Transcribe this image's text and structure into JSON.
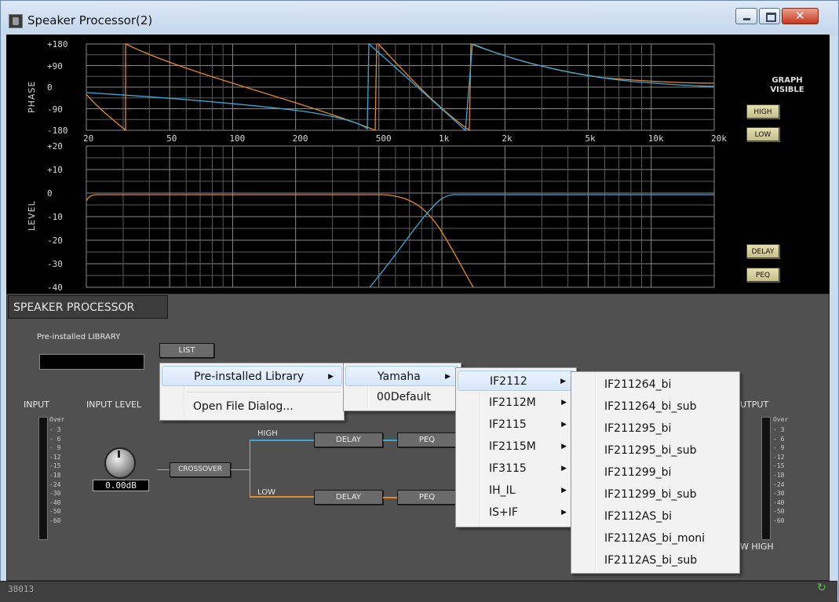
{
  "window": {
    "title": "Speaker Processor(2)"
  },
  "graph": {
    "phase_label": "PHASE",
    "level_label": "LEVEL",
    "phase_ticks": [
      "+180",
      "+90",
      "0",
      "-90",
      "-180"
    ],
    "level_ticks": [
      "+20",
      "+10",
      "0",
      "-10",
      "-20",
      "-30",
      "-40"
    ],
    "freq_ticks": [
      "20",
      "50",
      "100",
      "200",
      "500",
      "1k",
      "2k",
      "5k",
      "10k",
      "20k"
    ],
    "graph_visible_label_1": "GRAPH",
    "graph_visible_label_2": "VISIBLE",
    "high_button": "HIGH",
    "low_button": "LOW",
    "delay_button": "DELAY",
    "peq_button": "PEQ",
    "colors": {
      "high": "#3aa8d8",
      "low": "#e08a28",
      "grid": "#5a5a5a"
    }
  },
  "panel": {
    "tab_label": "SPEAKER PROCESSOR",
    "library_label": "Pre-installed LIBRARY",
    "list_button": "LIST",
    "input_label": "INPUT",
    "input_level_label": "INPUT LEVEL",
    "output_label": "UTPUT",
    "input_level_value": "0.00dB",
    "meter_scale": [
      "Over",
      "- 3",
      "- 6",
      "- 9",
      "-12",
      "-15",
      "-18",
      "-24",
      "-30",
      "-40",
      "-50",
      "-60"
    ],
    "crossover_button": "CROSSOVER",
    "high_label": "HIGH",
    "low_label": "LOW",
    "delay_label": "DELAY",
    "peq_label": "PEQ",
    "out_bottom_label": "W  HIGH"
  },
  "status": {
    "text": "38013"
  },
  "menus": {
    "main": [
      {
        "label": "Pre-installed Library",
        "submenu": true
      },
      {
        "label": "Open File Dialog...",
        "submenu": false
      }
    ],
    "maker": [
      {
        "label": "Yamaha",
        "submenu": true
      },
      {
        "label": "00Default",
        "submenu": false
      }
    ],
    "series": [
      "IF2112",
      "IF2112M",
      "IF2115",
      "IF2115M",
      "IF3115",
      "IH_IL",
      "IS+IF"
    ],
    "presets": [
      "IF211264_bi",
      "IF211264_bi_sub",
      "IF211295_bi",
      "IF211295_bi_sub",
      "IF211299_bi",
      "IF211299_bi_sub",
      "IF2112AS_bi",
      "IF2112AS_bi_moni",
      "IF2112AS_bi_sub"
    ]
  }
}
